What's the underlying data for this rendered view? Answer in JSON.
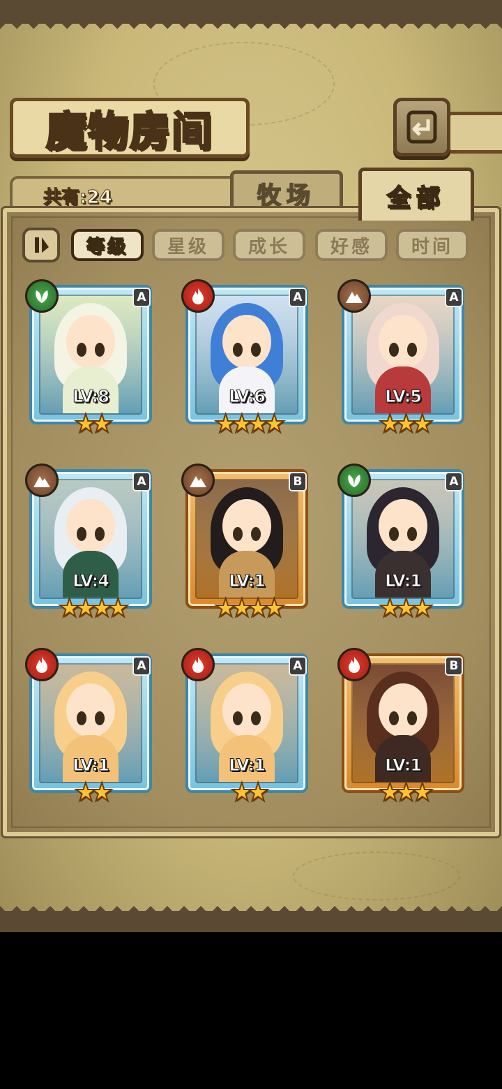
{
  "screen_title": "魔物房间",
  "count_label": "共有:24",
  "tabs": {
    "farm": "牧场",
    "all": "全部",
    "active": "全部"
  },
  "sort_buttons": [
    "等级",
    "星级",
    "成长",
    "好感",
    "时间"
  ],
  "sort_active": "等级",
  "icons": {
    "back": "back-arrow-icon",
    "sort_toggle": "sort-order-icon"
  },
  "colors": {
    "rank_A_frame": "#79c3e0",
    "rank_B_frame": "#d98a2c",
    "fire": "#c52a1e",
    "earth": "#8a5a3a",
    "wood": "#3a8a3c",
    "star": "#ffc52e"
  },
  "monsters": [
    {
      "element": "wood",
      "rank": "A",
      "level": "LV:8",
      "stars": "★★",
      "star_count": 2,
      "hair": "#f4f4e4",
      "outfit": "#e8efd0",
      "bg": "#dde9c0"
    },
    {
      "element": "fire",
      "rank": "A",
      "level": "LV:6",
      "stars": "★★★★",
      "star_count": 4,
      "hair": "#3f7fd6",
      "outfit": "#f4f4f8",
      "bg": "#cfe0f2"
    },
    {
      "element": "earth",
      "rank": "A",
      "level": "LV:5",
      "stars": "★★★",
      "star_count": 3,
      "hair": "#f0d8cf",
      "outfit": "#b83a3a",
      "bg": "#e9d6c4"
    },
    {
      "element": "earth",
      "rank": "A",
      "level": "LV:4",
      "stars": "★★★★",
      "star_count": 4,
      "hair": "#e8eef2",
      "outfit": "#2f5e48",
      "bg": "#b8c9c2"
    },
    {
      "element": "earth",
      "rank": "B",
      "level": "LV:1",
      "stars": "★★★★",
      "star_count": 4,
      "hair": "#231c1c",
      "outfit": "#c79a5a",
      "bg": "#8a6a4a"
    },
    {
      "element": "wood",
      "rank": "A",
      "level": "LV:1",
      "stars": "★★★",
      "star_count": 3,
      "hair": "#2c2630",
      "outfit": "#3a3030",
      "bg": "#c9c6b8"
    },
    {
      "element": "fire",
      "rank": "A",
      "level": "LV:1",
      "stars": "★★",
      "star_count": 2,
      "hair": "#f8cf8a",
      "outfit": "#f3c278",
      "bg": "#c8b89a"
    },
    {
      "element": "fire",
      "rank": "A",
      "level": "LV:1",
      "stars": "★★",
      "star_count": 2,
      "hair": "#f8cf8a",
      "outfit": "#f3c278",
      "bg": "#c8b89a"
    },
    {
      "element": "fire",
      "rank": "B",
      "level": "LV:1",
      "stars": "★★★",
      "star_count": 3,
      "hair": "#5a2f1e",
      "outfit": "#3e2a22",
      "bg": "#7a4a34"
    }
  ]
}
